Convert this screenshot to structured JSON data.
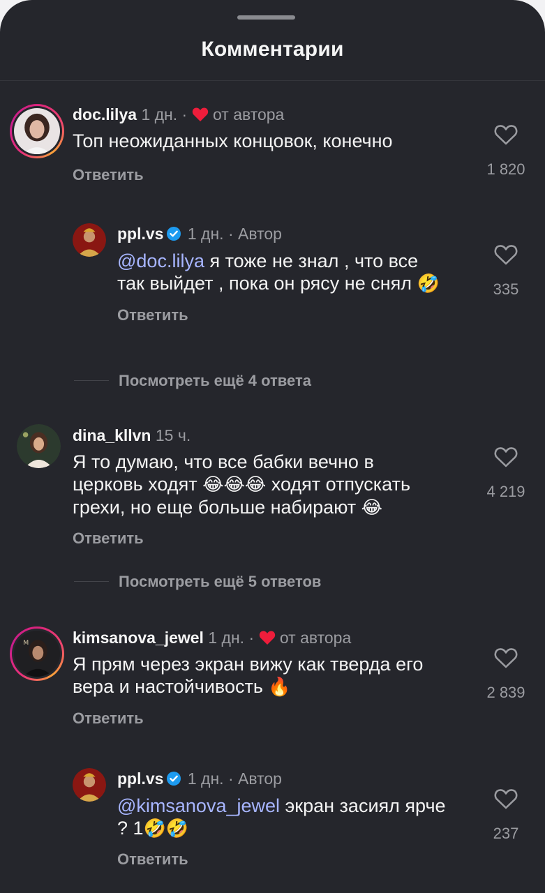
{
  "header": {
    "title": "Комментарии"
  },
  "colors": {
    "background": "#25262c",
    "muted": "#9b9ca1",
    "mention": "#a7b5ff",
    "heart": "#ee1d3b",
    "verified": "#1d9bf0"
  },
  "comments": [
    {
      "user": "doc.lilya",
      "time": "1 дн.",
      "dot": "·",
      "tag": "от автора",
      "text": "Топ неожиданных концовок, конечно",
      "reply_label": "Ответить",
      "likes": "1 820",
      "icons": {
        "avatar": "avatar-doc-lilya",
        "like": "heart-outline-icon",
        "author_like": "heart-filled-icon"
      }
    },
    {
      "user": "ppl.vs",
      "time": "1 дн.",
      "dot": "·",
      "tag": "Автор",
      "mention": "@doc.lilya",
      "text_part1": " я тоже не знал , что все",
      "text_line2": "так выйдет , пока он рясу не снял ",
      "emoji_1": "🤣",
      "reply_label": "Ответить",
      "likes": "335"
    },
    {
      "more_replies": "Посмотреть ещё 4 ответа"
    },
    {
      "user": "dina_kllvn",
      "time": "15 ч.",
      "text_line1": "Я то думаю, что все бабки вечно в",
      "text_line2a": "церковь ходят ",
      "emoji_laugh": "😂",
      "text_line2b": " ходят отпускать",
      "text_line3": "грехи, но еще больше набирают ",
      "reply_label": "Ответить",
      "likes": "4 219"
    },
    {
      "more_replies": "Посмотреть ещё 5 ответов"
    },
    {
      "user": "kimsanova_jewel",
      "time": "1 дн.",
      "dot": "·",
      "tag": "от автора",
      "text_line1": "Я прям через экран вижу как тверда его",
      "text_line2": "вера и настойчивость ",
      "emoji_fire": "🔥",
      "reply_label": "Ответить",
      "likes": "2 839"
    },
    {
      "user": "ppl.vs",
      "time": "1 дн.",
      "dot": "·",
      "tag": "Автор",
      "mention": "@kimsanova_jewel",
      "text_part1": " экран засиял ярче",
      "text_line2": "? 1",
      "emoji_1": "🤣",
      "reply_label": "Ответить",
      "likes": "237"
    }
  ]
}
